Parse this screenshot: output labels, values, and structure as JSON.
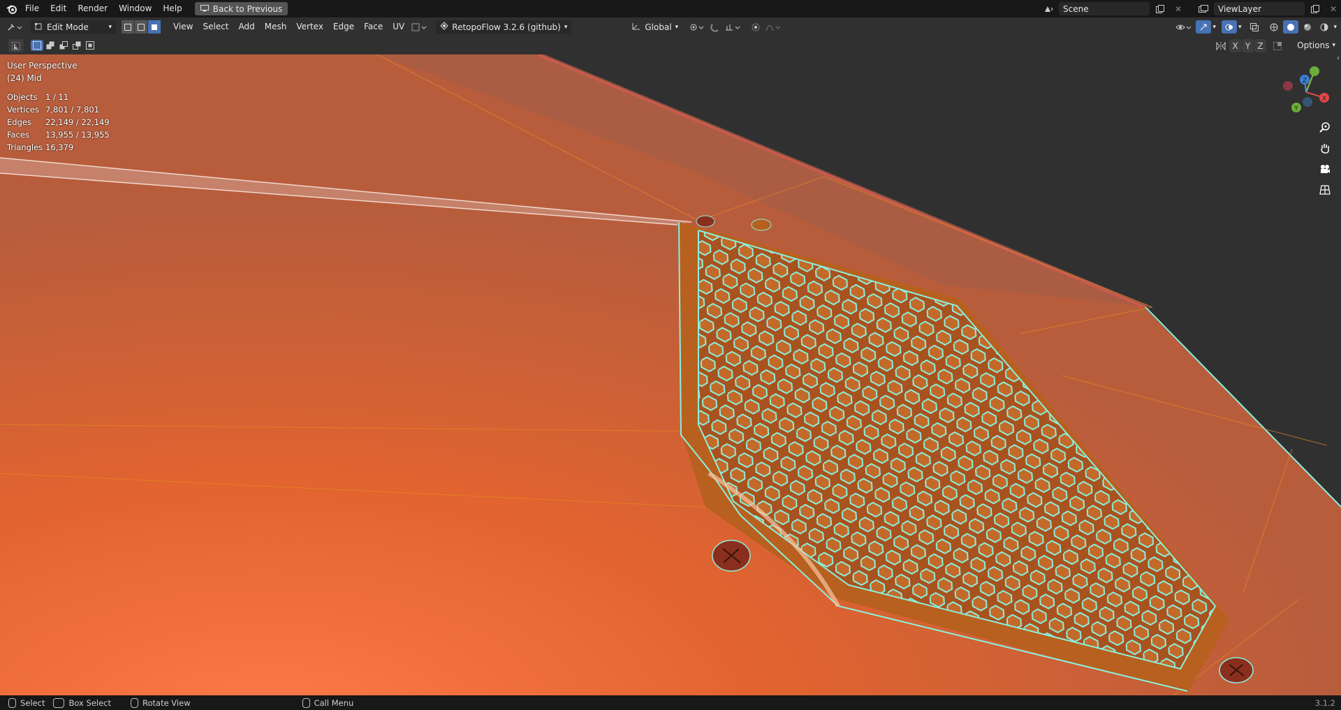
{
  "topbar": {
    "menu": [
      "File",
      "Edit",
      "Render",
      "Window",
      "Help"
    ],
    "back_label": "Back to Previous",
    "scene_name": "Scene",
    "view_layer": "ViewLayer"
  },
  "header": {
    "mode": "Edit Mode",
    "menus": [
      "View",
      "Select",
      "Add",
      "Mesh",
      "Vertex",
      "Edge",
      "Face",
      "UV"
    ],
    "addon": "RetopoFlow 3.2.6 (github)",
    "orientation": "Global"
  },
  "subheader": {
    "axes": [
      "X",
      "Y",
      "Z"
    ],
    "options_label": "Options"
  },
  "viewport": {
    "perspective": "User Perspective",
    "collection": "(24) Mid",
    "stats": [
      {
        "label": "Objects",
        "value": "1 / 11"
      },
      {
        "label": "Vertices",
        "value": "7,801 / 7,801"
      },
      {
        "label": "Edges",
        "value": "22,149 / 22,149"
      },
      {
        "label": "Faces",
        "value": "13,955 / 13,955"
      },
      {
        "label": "Triangles",
        "value": "16,379"
      }
    ]
  },
  "statusbar": {
    "select": "Select",
    "box_select": "Box Select",
    "rotate_view": "Rotate View",
    "call_menu": "Call Menu",
    "version": "3.1.2"
  },
  "colors": {
    "accent": "#4772b3",
    "mesh_edge": "#7fe7d4",
    "surface": "#e0632c"
  }
}
